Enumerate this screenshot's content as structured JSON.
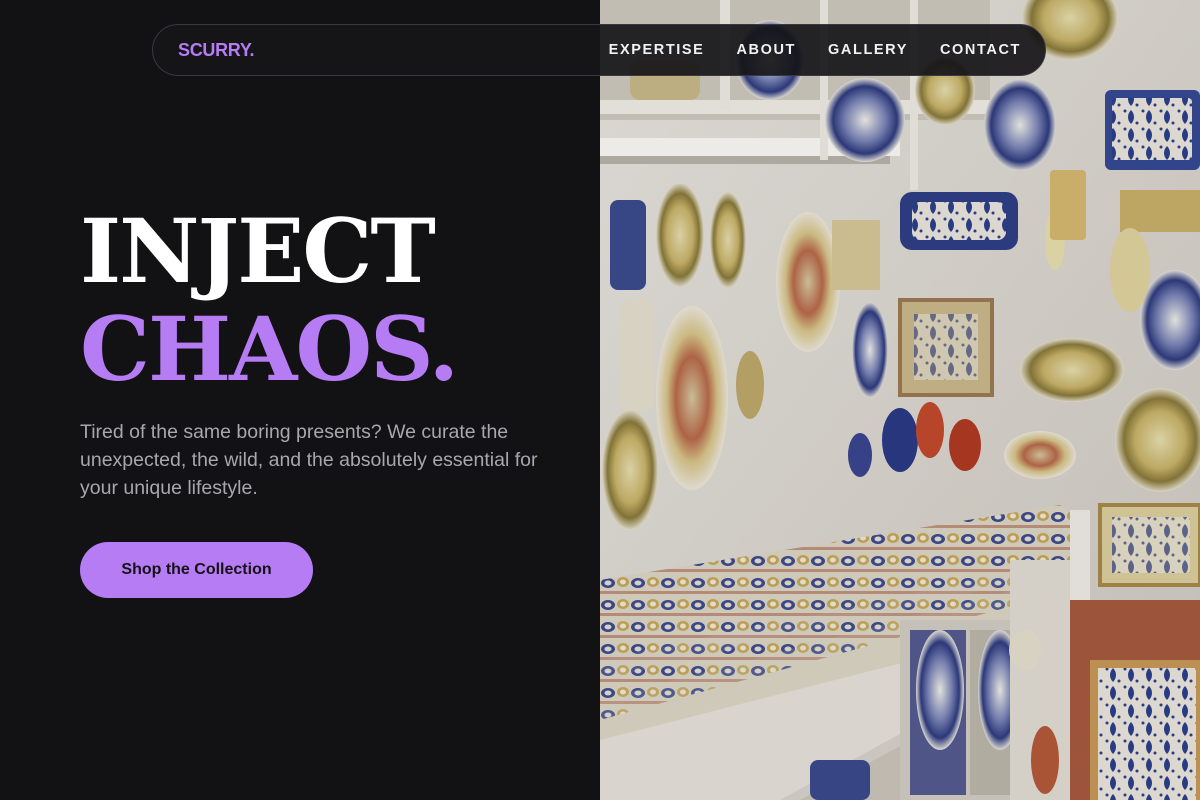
{
  "brand": {
    "logo_text": "SCURRY.",
    "accent_color": "#b67cf4",
    "background_color": "#121113"
  },
  "nav": {
    "items": [
      {
        "label": "EXPERTISE"
      },
      {
        "label": "ABOUT"
      },
      {
        "label": "GALLERY"
      },
      {
        "label": "CONTACT"
      }
    ]
  },
  "hero": {
    "headline_line1": "INJECT",
    "headline_line2": "CHAOS.",
    "tagline": "Tired of the same boring presents? We curate the unexpected, the wild, and the absolutely essential for your unique lifestyle.",
    "cta_label": "Shop the Collection",
    "image": {
      "alt": "Shop wall of hand-painted ceramic plates and pottery"
    }
  }
}
